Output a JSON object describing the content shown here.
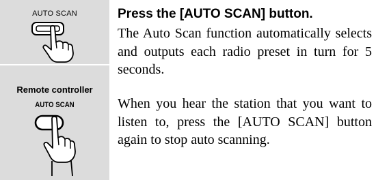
{
  "sidebar": {
    "main_unit_button_label": "AUTO SCAN",
    "remote_heading": "Remote controller",
    "remote_button_label": "AUTO SCAN",
    "illustration_top": "hand-pressing-button-icon",
    "illustration_bottom": "hand-pressing-remote-button-icon",
    "panel_color": "#dcdcdc"
  },
  "content": {
    "heading": "Press the [AUTO SCAN] button.",
    "paragraphs": [
      "The Auto Scan function automatically selects and outputs each radio preset in turn for 5 seconds.",
      "When you hear the station that you want to listen to, press the [AUTO SCAN] button again to stop auto scanning."
    ]
  }
}
